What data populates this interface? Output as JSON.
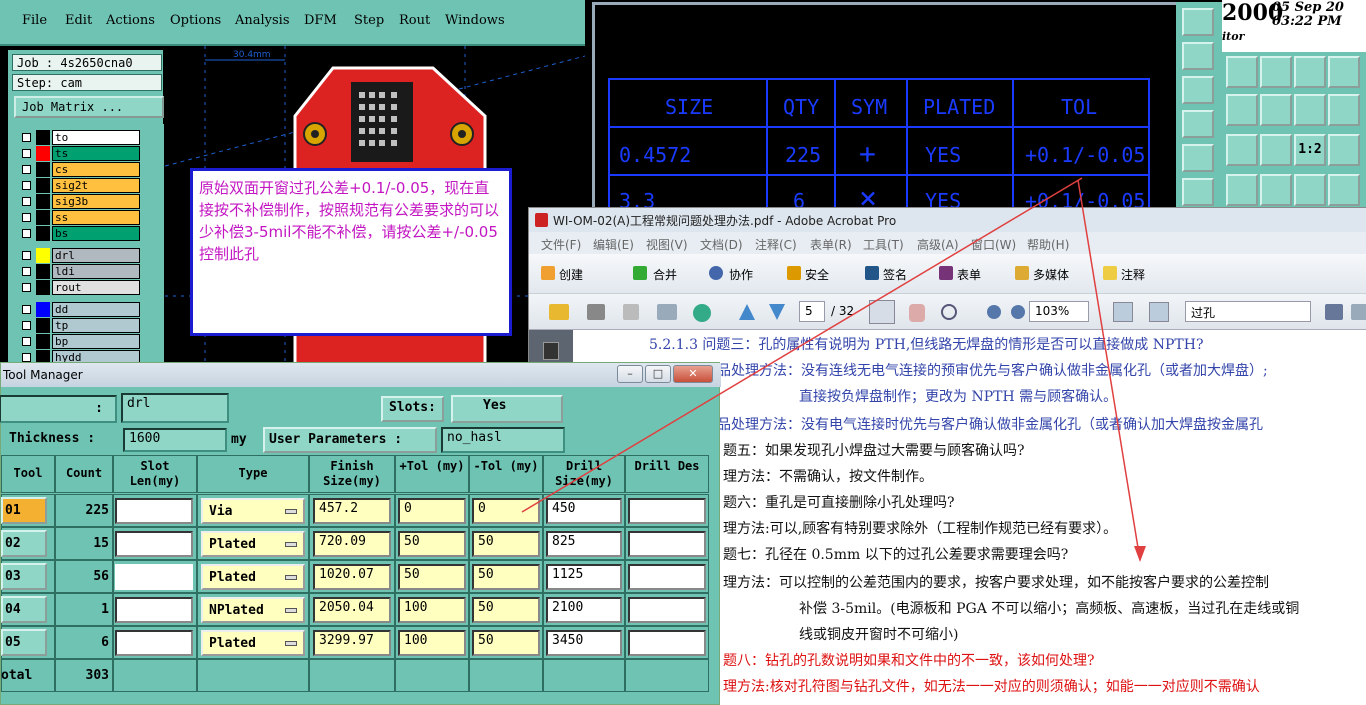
{
  "cam": {
    "menu": [
      "File",
      "Edit",
      "Actions",
      "Options",
      "Analysis",
      "DFM",
      "Step",
      "Rout",
      "Windows"
    ],
    "job_label": "Job : 4s2650cna0",
    "step_label": "Step: cam",
    "job_matrix": "Job Matrix ...",
    "dimension": "30.4mm",
    "layers": [
      {
        "name": "to",
        "color": "#ffffff",
        "swatch": "#000000"
      },
      {
        "name": "ts",
        "color": "#00a070",
        "swatch": "#ff0000"
      },
      {
        "name": "cs",
        "color": "#ffc040",
        "swatch": "#000000"
      },
      {
        "name": "sig2t",
        "color": "#ffc040",
        "swatch": "#000000"
      },
      {
        "name": "sig3b",
        "color": "#ffc040",
        "swatch": "#000000"
      },
      {
        "name": "ss",
        "color": "#ffc040",
        "swatch": "#000000"
      },
      {
        "name": "bs",
        "color": "#00a070",
        "swatch": "#000000"
      },
      {
        "name": "drl",
        "color": "#b0b8c0",
        "swatch": "#ffff00"
      },
      {
        "name": "ldi",
        "color": "#b0b8c0",
        "swatch": "#000000"
      },
      {
        "name": "rout",
        "color": "#e0e0e0",
        "swatch": "#000000"
      },
      {
        "name": "dd",
        "color": "#b0c8d0",
        "swatch": "#0000ff"
      },
      {
        "name": "tp",
        "color": "#b0c8d0",
        "swatch": "#000000"
      },
      {
        "name": "bp",
        "color": "#b0c8d0",
        "swatch": "#000000"
      },
      {
        "name": "hydd",
        "color": "#b0c8d0",
        "swatch": "#000000"
      }
    ]
  },
  "note": "原始双面开窗过孔公差+0.1/-0.05，现在直接按不补偿制作，按照规范有公差要求的可以少补偿3-5mil不能不补偿，请按公差+/-0.05控制此孔",
  "drill_view": {
    "headers": [
      "SIZE",
      "QTY",
      "SYM",
      "PLATED",
      "TOL"
    ],
    "rows": [
      {
        "size": "0.4572",
        "qty": "225",
        "sym": "+",
        "plated": "YES",
        "tol": "+0.1/-0.05"
      },
      {
        "size": "3.3",
        "qty": "6",
        "sym": "×",
        "plated": "YES",
        "tol": "+0.1/-0.05"
      }
    ]
  },
  "clock": {
    "year": "2000",
    "date": "05 Sep 20",
    "time": "03:22 PM",
    "sub": "itor"
  },
  "acrobat": {
    "title": "WI-OM-02(A)工程常规问题处理办法.pdf - Adobe Acrobat Pro",
    "menu": [
      "文件(F)",
      "编辑(E)",
      "视图(V)",
      "文档(D)",
      "注释(C)",
      "表单(R)",
      "工具(T)",
      "高级(A)",
      "窗口(W)",
      "帮助(H)"
    ],
    "tools": [
      "创建",
      "合并",
      "协作",
      "安全",
      "签名",
      "表单",
      "多媒体",
      "注释"
    ],
    "page": "5",
    "page_total": "/ 32",
    "zoom": "103%",
    "search": "过孔",
    "lines": [
      "5.2.1.3 问题三：孔的属性有说明为 PTH,但线路无焊盘的情形是否可以直接做成 NPTH?",
      "品处理方法：没有连线无电气连接的预审优先与客户确认做非金属化孔（或者加大焊盘）;",
      "直接按负焊盘制作；更改为 NPTH 需与顾客确认。",
      "品处理方法：没有电气连接时优先与客户确认做非金属化孔（或者确认加大焊盘按金属孔",
      "题五：如果发现孔小焊盘过大需要与顾客确认吗?",
      "理方法：不需确认，按文件制作。",
      "题六：重孔是可直接删除小孔处理吗?",
      "理方法:可以,顾客有特别要求除外（工程制作规范已经有要求）。",
      "题七：孔径在 0.5mm 以下的过孔公差要求需要理会吗?",
      "理方法：可以控制的公差范围内的要求，按客户要求处理，如不能按客户要求的公差控制",
      "补偿 3-5mil。(电源板和 PGA 不可以缩小；高频板、高速板，当过孔在走线或铜",
      "线或铜皮开窗时不可缩小)",
      "题八：钻孔的孔数说明如果和文件中的不一致，该如何处理?",
      "理方法:核对孔符图与钻孔文件，如无法一一对应的则须确认；如能一一对应则不需确认"
    ]
  },
  "tool_manager": {
    "title": "Tool Manager",
    "drl": "drl",
    "slots_label": "Slots:",
    "slots_value": "Yes",
    "thickness_label": "Thickness :",
    "thickness_value": "1600",
    "thickness_unit": "my",
    "user_params_label": "User Parameters :",
    "user_params_value": "no_hasl",
    "headers": [
      "Tool",
      "Count",
      "Slot Len(my)",
      "Type",
      "Finish Size(my)",
      "+Tol (my)",
      "-Tol (my)",
      "Drill Size(my)",
      "Drill Des"
    ],
    "rows": [
      {
        "tool": "01",
        "count": "225",
        "slot": "",
        "type": "Via",
        "finish": "457.2",
        "ptol": "0",
        "ntol": "0",
        "drill": "450",
        "des": ""
      },
      {
        "tool": "02",
        "count": "15",
        "slot": "",
        "type": "Plated",
        "finish": "720.09",
        "ptol": "50",
        "ntol": "50",
        "drill": "825",
        "des": ""
      },
      {
        "tool": "03",
        "count": "56",
        "slot": "",
        "type": "Plated",
        "finish": "1020.07",
        "ptol": "50",
        "ntol": "50",
        "drill": "1125",
        "des": ""
      },
      {
        "tool": "04",
        "count": "1",
        "slot": "",
        "type": "NPlated",
        "finish": "2050.04",
        "ptol": "100",
        "ntol": "50",
        "drill": "2100",
        "des": ""
      },
      {
        "tool": "05",
        "count": "6",
        "slot": "",
        "type": "Plated",
        "finish": "3299.97",
        "ptol": "100",
        "ntol": "50",
        "drill": "3450",
        "des": ""
      }
    ],
    "total_label": "otal",
    "total_count": "303"
  },
  "colors": {
    "panel": "#6fc3b3",
    "drill_text": "#1a3bff",
    "note_text": "#c216c2",
    "arrow": "#e04040"
  }
}
